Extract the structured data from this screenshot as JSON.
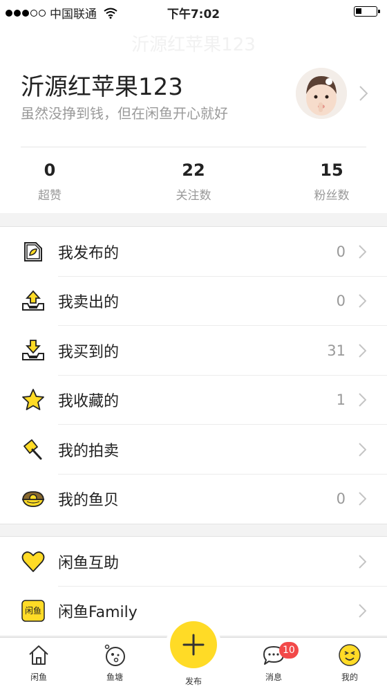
{
  "status_bar": {
    "carrier": "中国联通",
    "time": "下午7:02"
  },
  "nav": {
    "faded_title": "沂源红苹果123"
  },
  "profile": {
    "username": "沂源红苹果123",
    "motto": "虽然没挣到钱，但在闲鱼开心就好",
    "stats": [
      {
        "value": "0",
        "label": "超赞"
      },
      {
        "value": "22",
        "label": "关注数"
      },
      {
        "value": "15",
        "label": "粉丝数"
      }
    ]
  },
  "menu_group_1": [
    {
      "icon": "document-leaf-icon",
      "label": "我发布的",
      "count": "0"
    },
    {
      "icon": "tray-upload-icon",
      "label": "我卖出的",
      "count": "0"
    },
    {
      "icon": "tray-download-icon",
      "label": "我买到的",
      "count": "31"
    },
    {
      "icon": "star-icon",
      "label": "我收藏的",
      "count": "1"
    },
    {
      "icon": "auction-hammer-icon",
      "label": "我的拍卖",
      "count": ""
    },
    {
      "icon": "shell-icon",
      "label": "我的鱼贝",
      "count": "0"
    }
  ],
  "menu_group_2": [
    {
      "icon": "heart-icon",
      "label": "闲鱼互助"
    },
    {
      "icon": "family-badge-icon",
      "label": "闲鱼Family",
      "badge_text": "闲鱼"
    }
  ],
  "tabbar": {
    "items": [
      {
        "icon": "house-icon",
        "label": "闲鱼"
      },
      {
        "icon": "pond-icon",
        "label": "鱼塘"
      },
      {
        "icon": "plus-icon",
        "label": "发布"
      },
      {
        "icon": "chat-bubble-icon",
        "label": "消息",
        "badge": "10"
      },
      {
        "icon": "smiley-icon",
        "label": "我的"
      }
    ]
  },
  "colors": {
    "accent": "#ffdb26",
    "badge": "#f24949",
    "text_muted": "#999999"
  }
}
